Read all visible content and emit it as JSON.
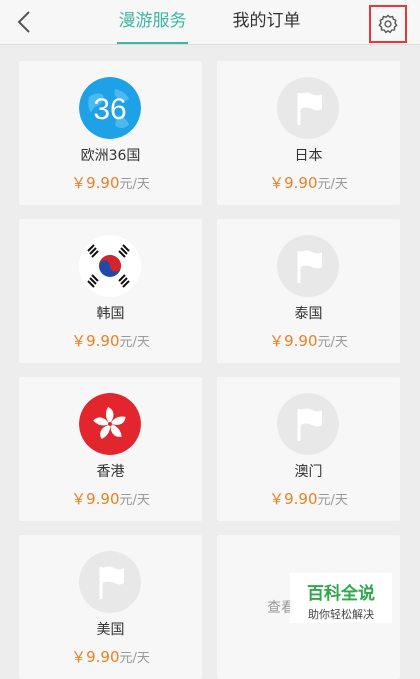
{
  "header": {
    "tabs": [
      {
        "label": "漫游服务",
        "active": true
      },
      {
        "label": "我的订单",
        "active": false
      }
    ]
  },
  "cards": [
    {
      "name": "欧洲36国",
      "price": "￥9.90",
      "unit": "元/天",
      "icon": "europe-36-icon",
      "badge": "36"
    },
    {
      "name": "日本",
      "price": "￥9.90",
      "unit": "元/天",
      "icon": "flag-placeholder-icon"
    },
    {
      "name": "韩国",
      "price": "￥9.90",
      "unit": "元/天",
      "icon": "korea-flag-icon"
    },
    {
      "name": "泰国",
      "price": "￥9.90",
      "unit": "元/天",
      "icon": "flag-placeholder-icon"
    },
    {
      "name": "香港",
      "price": "￥9.90",
      "unit": "元/天",
      "icon": "hongkong-flag-icon"
    },
    {
      "name": "澳门",
      "price": "￥9.90",
      "unit": "元/天",
      "icon": "flag-placeholder-icon"
    },
    {
      "name": "美国",
      "price": "￥9.90",
      "unit": "元/天",
      "icon": "flag-placeholder-icon"
    }
  ],
  "more": {
    "label": "查看"
  },
  "watermark": {
    "title": "百科全说",
    "subtitle": "助你轻松解决"
  },
  "colors": {
    "accent": "#3fb6a2",
    "price": "#ef7f20",
    "highlight": "#e03a3a"
  }
}
